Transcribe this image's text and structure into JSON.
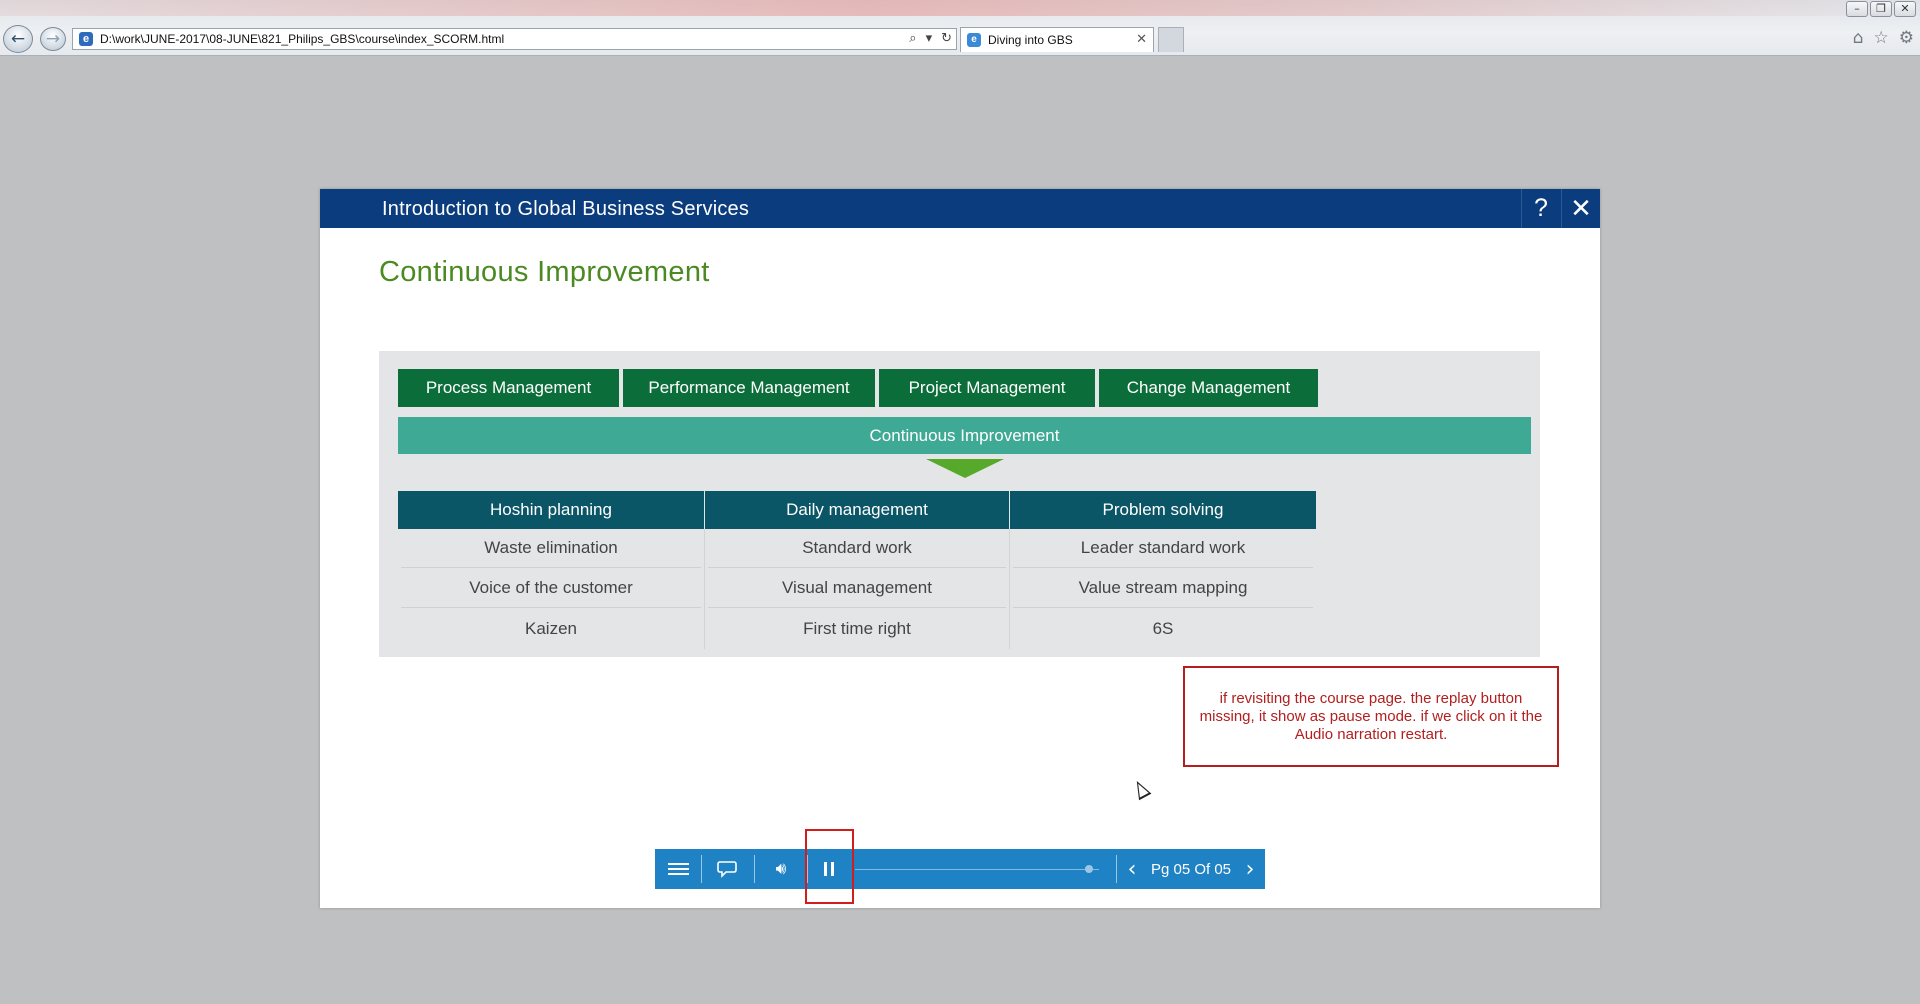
{
  "browser": {
    "address": "D:\\work\\JUNE-2017\\08-JUNE\\821_Philips_GBS\\course\\index_SCORM.html",
    "tab_title": "Diving into GBS",
    "window_controls": [
      "minimize-icon",
      "restore-icon",
      "close-icon"
    ],
    "address_tools": [
      "search-icon",
      "dropdown-icon",
      "refresh-icon"
    ],
    "toolbar_icons": [
      "home-icon",
      "star-icon",
      "gear-icon"
    ]
  },
  "course": {
    "title": "Introduction to Global Business Services",
    "help_label": "?",
    "close_label": "✕",
    "page_title": "Continuous Improvement",
    "diagram": {
      "top_boxes": [
        "Process Management",
        "Performance Management",
        "Project Management",
        "Change Management"
      ],
      "center_bar": "Continuous Improvement",
      "columns": [
        {
          "header": "Hoshin planning",
          "items": [
            "Waste elimination",
            "Voice of the customer",
            "Kaizen"
          ]
        },
        {
          "header": "Daily management",
          "items": [
            "Standard work",
            "Visual management",
            "First time right"
          ]
        },
        {
          "header": "Problem solving",
          "items": [
            "Leader standard work",
            "Value stream mapping",
            "6S"
          ]
        }
      ]
    },
    "note": "if revisiting the course page. the replay button missing, it show as pause mode. if we click on it the Audio narration restart.",
    "player": {
      "page_label": "Pg 05 Of 05",
      "progress": 1.0,
      "state": "paused-mode"
    }
  },
  "colors": {
    "header_blue": "#0b3c7d",
    "title_green": "#4b8a22",
    "box_green": "#0b6e3a",
    "teal_bar": "#3ea994",
    "column_header": "#0a5566",
    "player_blue": "#1e82c4",
    "annotation_red": "#b31e1e"
  }
}
